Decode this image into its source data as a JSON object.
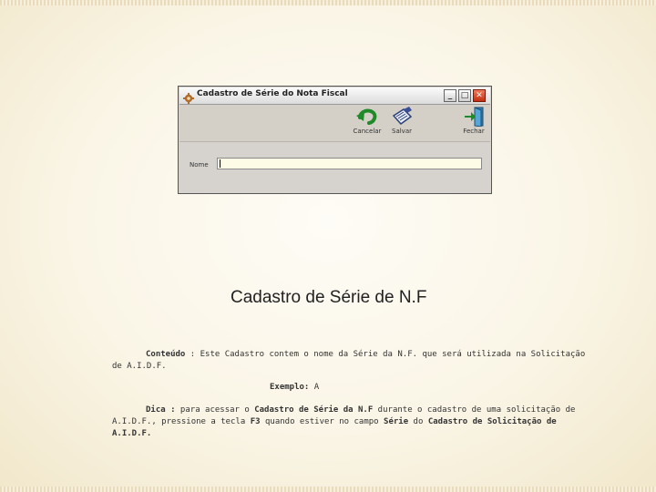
{
  "window": {
    "title": "Cadastro de Série do Nota Fiscal",
    "buttons": {
      "minimize": "_",
      "maximize": "□",
      "close": "✕"
    },
    "toolbar": {
      "cancel_label": "Cancelar",
      "save_label": "Salvar",
      "exit_label": "Fechar"
    },
    "form": {
      "name_label": "Nome",
      "name_value": ""
    },
    "icons": {
      "app": "gear-icon",
      "cancel": "undo-arrow-icon",
      "save": "save-icon",
      "exit": "exit-door-icon"
    }
  },
  "slide": {
    "heading": "Cadastro de Série de N.F",
    "content_label": "Conteúdo",
    "content_text": " : Este Cadastro contem o nome da Série da N.F. que será utilizada na Solicitação",
    "content_text_2": "de A.I.D.F.",
    "example_label": "Exemplo:",
    "example_value": " A",
    "tip_label": "Dica :",
    "tip_text_1": " para acessar o ",
    "tip_bold_1": "Cadastro de Série da N.F",
    "tip_text_2": " durante o cadastro de uma solicitação de",
    "tip_text_3": "A.I.D.F., pressione a tecla ",
    "tip_bold_2": "F3",
    "tip_text_4": " quando estiver no campo ",
    "tip_bold_3": "Série",
    "tip_text_5": " do ",
    "tip_bold_4": "Cadastro de Solicitação de",
    "tip_bold_5": "A.I.D.F."
  }
}
